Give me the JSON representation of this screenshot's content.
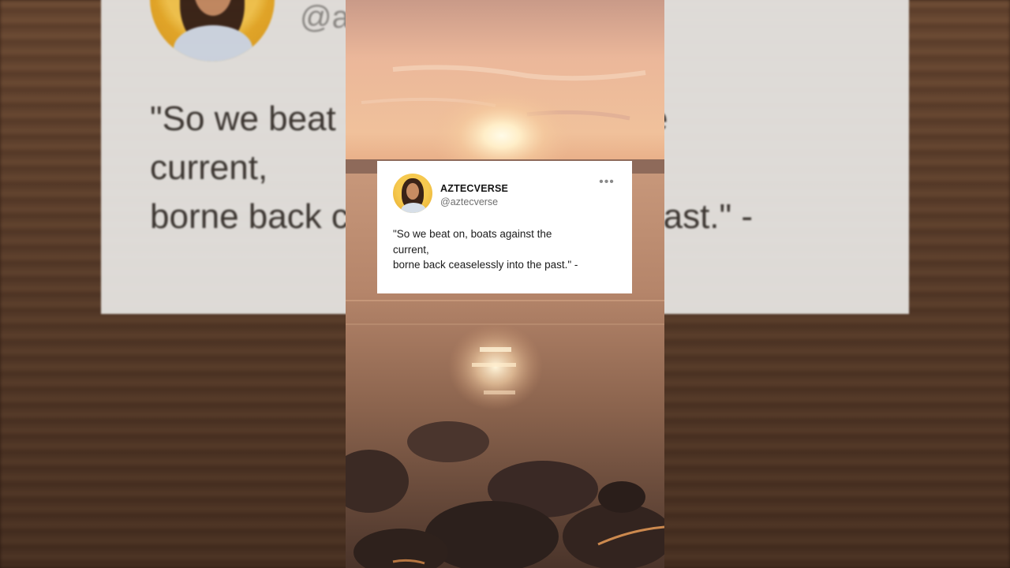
{
  "post": {
    "display_name": "AZTECVERSE",
    "handle": "@aztecverse",
    "quote": "\"So we beat on, boats against the\ncurrent,\nborne back ceaselessly into the past.\" -",
    "more_icon": "more-horizontal-icon",
    "more_glyph": "•••"
  },
  "background": {
    "handle_fragment": "@a",
    "quote_lines": "\"So we beat on, boats against the\ncurrent,\nborne back ceaselessly into the past.\" -"
  },
  "colors": {
    "card": "#ffffff",
    "avatar_ring": "#f2c04a",
    "sky_top": "#e9b896",
    "sun": "#fff6d8",
    "water": "#b08063"
  }
}
